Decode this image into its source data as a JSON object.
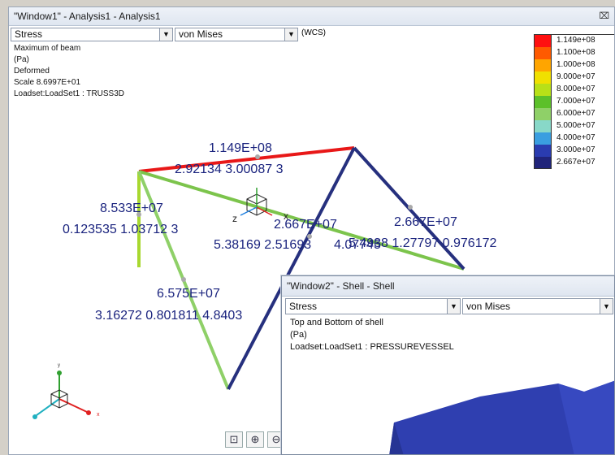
{
  "window1": {
    "title": "\"Window1\" - Analysis1 - Analysis1",
    "close_glyph": "⌧",
    "combo_quantity": "Stress",
    "combo_component": "von Mises",
    "coord_system": "(WCS)",
    "info_lines": [
      "Maximum of beam",
      "(Pa)",
      "Deformed",
      "Scale  8.6997E+01",
      "Loadset:LoadSet1 :  TRUSS3D"
    ],
    "legend": [
      {
        "label": "1.149e+08",
        "color": "#ff1010"
      },
      {
        "label": "1.100e+08",
        "color": "#ff5a00"
      },
      {
        "label": "1.000e+08",
        "color": "#ffa500"
      },
      {
        "label": "9.000e+07",
        "color": "#f0e000"
      },
      {
        "label": "8.000e+07",
        "color": "#b8e018"
      },
      {
        "label": "7.000e+07",
        "color": "#5cc02a"
      },
      {
        "label": "6.000e+07",
        "color": "#8fd068"
      },
      {
        "label": "5.000e+07",
        "color": "#88d8c8"
      },
      {
        "label": "4.000e+07",
        "color": "#3a9ee0"
      },
      {
        "label": "3.000e+07",
        "color": "#2a3cb0"
      },
      {
        "label": "2.667e+07",
        "color": "#20247a"
      }
    ],
    "annotations": [
      {
        "value": "1.149E+08",
        "coords": "2.92134  3.00087  3"
      },
      {
        "value": "8.533E+07",
        "coords": "0.123535  1.03712  3"
      },
      {
        "value": "2.667E+07",
        "coords": "5.38169  2.51693"
      },
      {
        "value": "2.667E+07",
        "coords": "5.4938 1.27797  0.976172"
      },
      {
        "value": "6.575E+07",
        "coords": "3.16272  0.801811  4.8403"
      },
      {
        "overlap_text": "4.07745"
      }
    ],
    "axis_labels": {
      "z": "z",
      "x": "x",
      "y": "y"
    },
    "zoom_buttons": [
      "⊡",
      "⊕",
      "⊖"
    ]
  },
  "window2": {
    "title": "\"Window2\" - Shell - Shell",
    "combo_quantity": "Stress",
    "combo_component": "von Mises",
    "info_lines": [
      "Top and Bottom of shell",
      "(Pa)",
      "Loadset:LoadSet1 :  PRESSUREVESSEL"
    ]
  }
}
